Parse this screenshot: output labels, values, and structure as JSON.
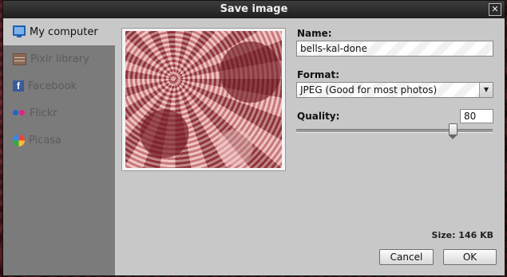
{
  "dialog": {
    "title": "Save image",
    "close_glyph": "✕"
  },
  "sidebar": {
    "items": [
      {
        "label": "My computer",
        "icon": "monitor-icon",
        "active": true
      },
      {
        "label": "Pixlr library",
        "icon": "library-icon",
        "active": false
      },
      {
        "label": "Facebook",
        "icon": "facebook-icon",
        "active": false
      },
      {
        "label": "Flickr",
        "icon": "flickr-icon",
        "active": false
      },
      {
        "label": "Picasa",
        "icon": "picasa-icon",
        "active": false
      }
    ],
    "facebook_glyph": "f"
  },
  "form": {
    "name_label": "Name:",
    "name_value": "bells-kal-done",
    "format_label": "Format:",
    "format_value": "JPEG (Good for most photos)",
    "quality_label": "Quality:",
    "quality_value": "80",
    "quality_level": 0.8,
    "size_text": "Size: 146 KB"
  },
  "buttons": {
    "cancel": "Cancel",
    "ok": "OK"
  },
  "colors": {
    "titlebar": "#2a2a2a",
    "panel": "#c8c8c8",
    "sidebar": "#7b7b7b"
  }
}
